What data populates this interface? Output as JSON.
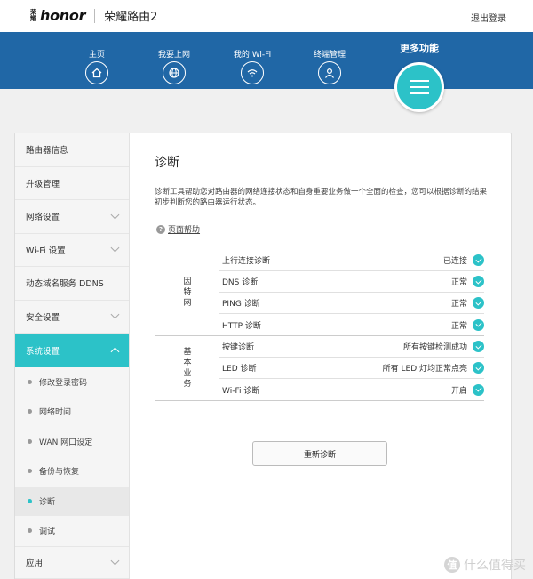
{
  "header": {
    "brand_mark": "荣耀",
    "brand_logo": "honor",
    "model": "荣耀路由2",
    "logout": "退出登录"
  },
  "nav": {
    "items": [
      {
        "label": "主页",
        "icon": "home-icon"
      },
      {
        "label": "我要上网",
        "icon": "globe-icon"
      },
      {
        "label": "我的 Wi-Fi",
        "icon": "wifi-icon"
      },
      {
        "label": "终端管理",
        "icon": "user-icon"
      }
    ],
    "more_label": "更多功能",
    "more_icon": "menu-icon"
  },
  "sidebar": {
    "items": [
      {
        "label": "路由器信息",
        "chevron": false
      },
      {
        "label": "升级管理",
        "chevron": false
      },
      {
        "label": "网络设置",
        "chevron": true
      },
      {
        "label": "Wi-Fi 设置",
        "chevron": true
      },
      {
        "label": "动态域名服务 DDNS",
        "chevron": false
      },
      {
        "label": "安全设置",
        "chevron": true
      },
      {
        "label": "系统设置",
        "chevron": true,
        "active": true
      }
    ],
    "sub_items": [
      {
        "label": "修改登录密码"
      },
      {
        "label": "网络时间"
      },
      {
        "label": "WAN 网口设定"
      },
      {
        "label": "备份与恢复"
      },
      {
        "label": "诊断",
        "current": true
      },
      {
        "label": "调试"
      }
    ],
    "bottom_item": {
      "label": "应用"
    }
  },
  "content": {
    "title": "诊断",
    "description": "诊断工具帮助您对路由器的网络连接状态和自身重要业务做一个全面的检查，您可以根据诊断的结果初步判断您的路由器运行状态。",
    "help_label": "页面帮助",
    "groups": [
      {
        "name": "因特网",
        "rows": [
          {
            "label": "上行连接诊断",
            "status": "已连接"
          },
          {
            "label": "DNS 诊断",
            "status": "正常"
          },
          {
            "label": "PING 诊断",
            "status": "正常"
          },
          {
            "label": "HTTP 诊断",
            "status": "正常"
          }
        ]
      },
      {
        "name": "基本业务",
        "rows": [
          {
            "label": "按键诊断",
            "status": "所有按键检测成功"
          },
          {
            "label": "LED 诊断",
            "status": "所有 LED 灯均正常点亮"
          },
          {
            "label": "Wi-Fi 诊断",
            "status": "开启"
          }
        ]
      }
    ],
    "rediagnose_button": "重新诊断"
  },
  "watermark": {
    "symbol": "值",
    "text": "什么值得买"
  },
  "colors": {
    "nav_blue": "#2067a6",
    "accent_teal": "#2cc2c8"
  }
}
